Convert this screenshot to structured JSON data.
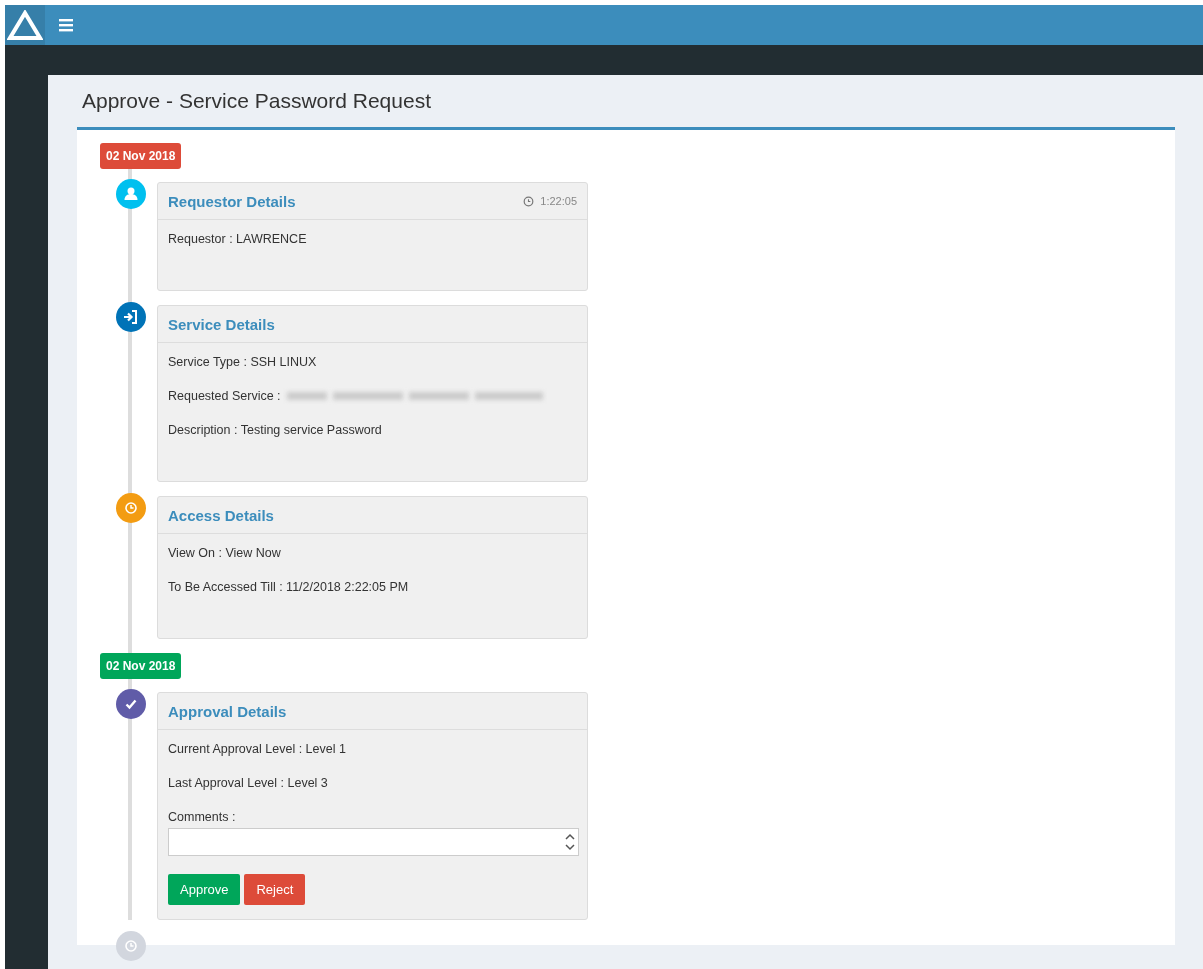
{
  "page_title": "Approve - Service Password Request",
  "timeline": [
    {
      "kind": "date",
      "label": "02 Nov 2018",
      "color": "#dd4b39"
    },
    {
      "kind": "entry",
      "color": "#00c0ef",
      "title": "Requestor Details",
      "time": "1:22:05",
      "lines": [
        {
          "text": "Requestor : LAWRENCE",
          "redacted": false
        }
      ]
    },
    {
      "kind": "entry",
      "color": "#0073b7",
      "title": "Service Details",
      "lines": [
        {
          "text": "Service Type : SSH LINUX",
          "redacted": false
        },
        {
          "text": "Requested Service :",
          "redacted": true
        },
        {
          "text": "Description : Testing service Password",
          "redacted": false
        }
      ]
    },
    {
      "kind": "entry",
      "color": "#f39c12",
      "title": "Access Details",
      "lines": [
        {
          "text": "View On : View Now",
          "redacted": false
        },
        {
          "text": "To Be Accessed Till : 11/2/2018 2:22:05 PM",
          "redacted": false
        }
      ]
    },
    {
      "kind": "date",
      "label": "02 Nov 2018",
      "color": "#00a65a"
    },
    {
      "kind": "entry",
      "color": "#605ca8",
      "title": "Approval Details",
      "lines": [
        {
          "text": "Current Approval Level : Level 1",
          "redacted": false
        },
        {
          "text": "Last Approval Level : Level 3",
          "redacted": false
        }
      ],
      "form": {
        "label": "Comments :",
        "buttons": [
          {
            "label": "Approve",
            "kind": "success"
          },
          {
            "label": "Reject",
            "kind": "danger"
          }
        ]
      }
    },
    {
      "kind": "end",
      "color": "#d2d6de"
    }
  ]
}
